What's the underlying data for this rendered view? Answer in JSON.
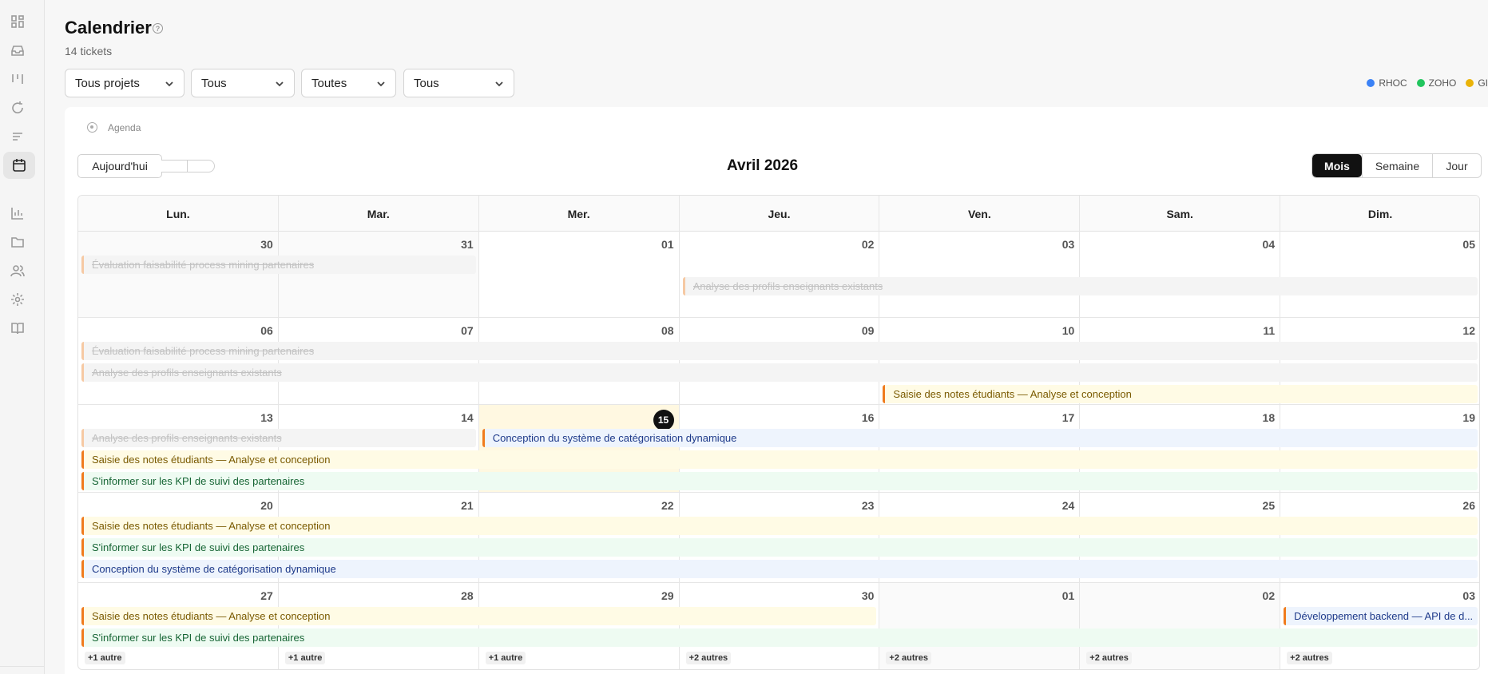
{
  "sidebar": {
    "items": [
      {
        "icon": "dashboard-icon"
      },
      {
        "icon": "inbox-icon"
      },
      {
        "icon": "board-icon"
      },
      {
        "icon": "refresh-icon"
      },
      {
        "icon": "list-icon"
      },
      {
        "icon": "calendar-icon",
        "active": true
      },
      {
        "icon": "chart-icon"
      },
      {
        "icon": "folder-icon"
      },
      {
        "icon": "users-icon"
      },
      {
        "icon": "gear-icon"
      },
      {
        "icon": "book-icon"
      }
    ]
  },
  "header": {
    "title": "Calendrier",
    "subtitle": "14 tickets"
  },
  "filters": [
    {
      "value": "Tous projets"
    },
    {
      "value": "Tous"
    },
    {
      "value": "Toutes"
    },
    {
      "value": "Tous"
    }
  ],
  "legend": [
    {
      "label": "RHOC",
      "color": "#3b82f6"
    },
    {
      "label": "ZOHO",
      "color": "#22c55e"
    },
    {
      "label": "GI",
      "color": "#eab308"
    }
  ],
  "toolbar": {
    "agenda_label": "Agenda",
    "today_label": "Aujourd'hui",
    "month_title": "Avril 2026",
    "views": [
      {
        "label": "Mois",
        "active": true
      },
      {
        "label": "Semaine",
        "active": false
      },
      {
        "label": "Jour",
        "active": false
      }
    ]
  },
  "calendar": {
    "weekdays": [
      "Lun.",
      "Mar.",
      "Mer.",
      "Jeu.",
      "Ven.",
      "Sam.",
      "Dim."
    ],
    "weeks": [
      {
        "days": [
          "30",
          "31",
          "01",
          "02",
          "03",
          "04",
          "05"
        ]
      },
      {
        "days": [
          "06",
          "07",
          "08",
          "09",
          "10",
          "11",
          "12"
        ]
      },
      {
        "days": [
          "13",
          "14",
          "15",
          "16",
          "17",
          "18",
          "19"
        ]
      },
      {
        "days": [
          "20",
          "21",
          "22",
          "23",
          "24",
          "25",
          "26"
        ]
      },
      {
        "days": [
          "27",
          "28",
          "29",
          "30",
          "01",
          "02",
          "03"
        ]
      }
    ],
    "outside_month": [
      [
        0,
        0
      ],
      [
        0,
        1
      ],
      [
        4,
        4
      ],
      [
        4,
        5
      ]
    ],
    "today": [
      2,
      2
    ],
    "events": [
      {
        "week": 0,
        "start": 0,
        "end": 1,
        "lane": 0,
        "title": "Évaluation faisabilité process mining partenaires",
        "style": "done"
      },
      {
        "week": 0,
        "start": 3,
        "end": 6,
        "lane": 1,
        "title": "Analyse des profils enseignants existants",
        "style": "done"
      },
      {
        "week": 1,
        "start": 0,
        "end": 6,
        "lane": 0,
        "title": "Évaluation faisabilité process mining partenaires",
        "style": "done"
      },
      {
        "week": 1,
        "start": 0,
        "end": 6,
        "lane": 1,
        "title": "Analyse des profils enseignants existants",
        "style": "done"
      },
      {
        "week": 1,
        "start": 4,
        "end": 6,
        "lane": 2,
        "title": "Saisie des notes étudiants — Analyse et conception",
        "style": "yellow"
      },
      {
        "week": 2,
        "start": 0,
        "end": 1,
        "lane": 0,
        "title": "Analyse des profils enseignants existants",
        "style": "done"
      },
      {
        "week": 2,
        "start": 2,
        "end": 6,
        "lane": 0,
        "title": "Conception du système de catégorisation dynamique",
        "style": "blue"
      },
      {
        "week": 2,
        "start": 0,
        "end": 6,
        "lane": 1,
        "title": "Saisie des notes étudiants — Analyse et conception",
        "style": "yellow"
      },
      {
        "week": 2,
        "start": 0,
        "end": 6,
        "lane": 2,
        "title": "S'informer sur les KPI de suivi des partenaires",
        "style": "green"
      },
      {
        "week": 3,
        "start": 0,
        "end": 6,
        "lane": 0,
        "title": "Saisie des notes étudiants — Analyse et conception",
        "style": "yellow"
      },
      {
        "week": 3,
        "start": 0,
        "end": 6,
        "lane": 1,
        "title": "S'informer sur les KPI de suivi des partenaires",
        "style": "green"
      },
      {
        "week": 3,
        "start": 0,
        "end": 6,
        "lane": 2,
        "title": "Conception du système de catégorisation dynamique",
        "style": "blue"
      },
      {
        "week": 4,
        "start": 0,
        "end": 3,
        "lane": 0,
        "title": "Saisie des notes étudiants — Analyse et conception",
        "style": "yellow"
      },
      {
        "week": 4,
        "start": 6,
        "end": 6,
        "lane": 0,
        "title": "Développement backend — API de d...",
        "style": "blue"
      },
      {
        "week": 4,
        "start": 0,
        "end": 6,
        "lane": 1,
        "title": "S'informer sur les KPI de suivi des partenaires",
        "style": "green"
      }
    ],
    "more_links": [
      "+1 autre",
      "+1 autre",
      "+1 autre",
      "+2 autres",
      "+2 autres",
      "+2 autres",
      "+2 autres"
    ]
  }
}
